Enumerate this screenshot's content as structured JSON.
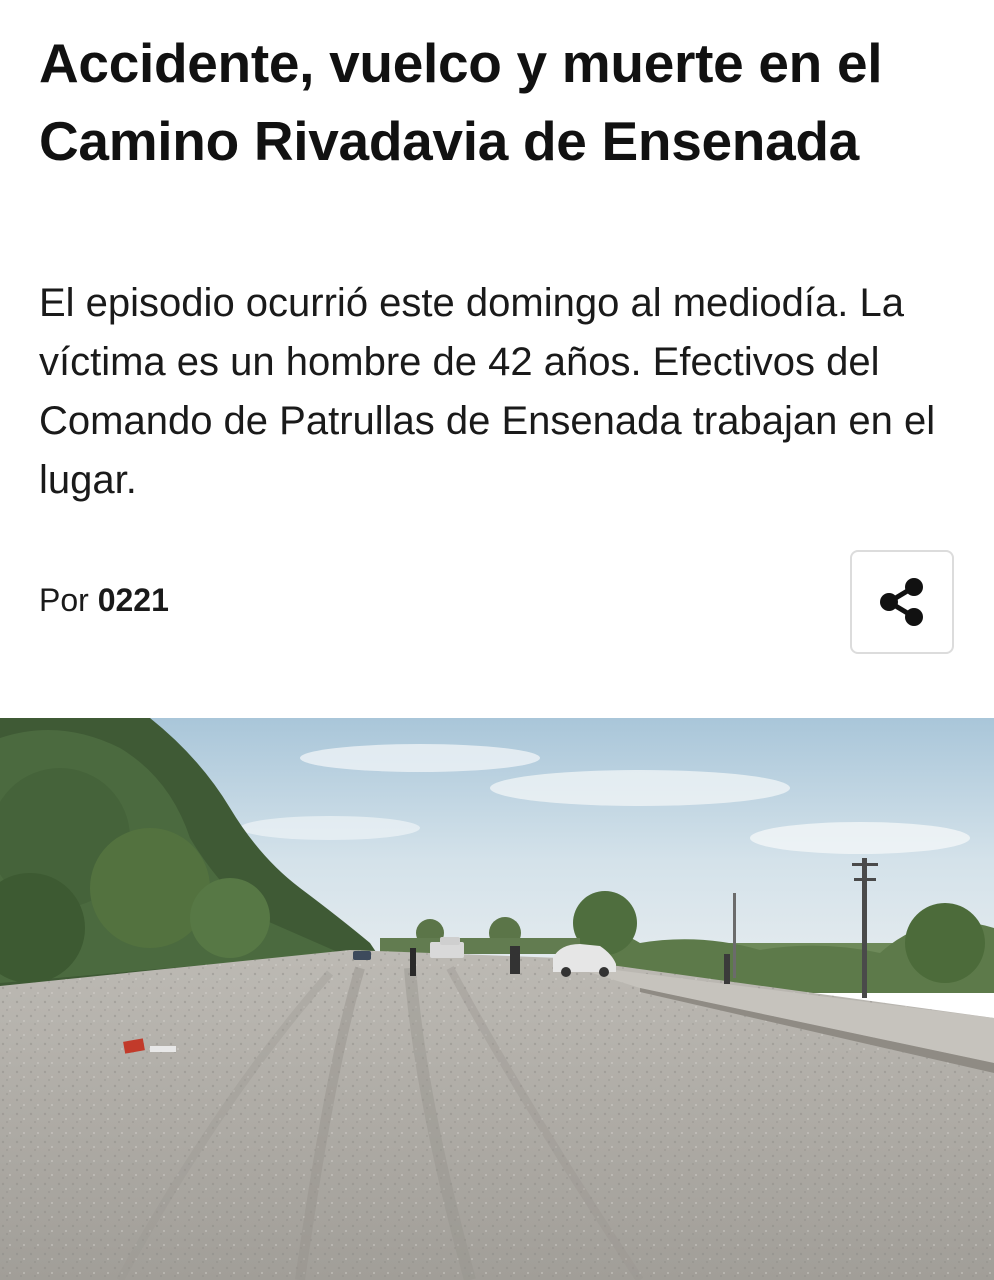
{
  "article": {
    "headline": "Accidente, vuelco y muerte en el Camino Rivadavia de Ensenada",
    "summary": "El episodio ocurrió este domingo al mediodía. La víctima es un hombre de 42 años. Efectivos del Comando de Patrullas de Ensenada trabajan en el lugar.",
    "byline_prefix": "Por",
    "byline_author": "0221",
    "share_icon": "share-icon",
    "photo": "road-accident-scene-photo"
  },
  "colors": {
    "text": "#111111",
    "button_border": "#dcdcdc",
    "sky": "#c9dbe6",
    "road": "#a9a6a0"
  }
}
